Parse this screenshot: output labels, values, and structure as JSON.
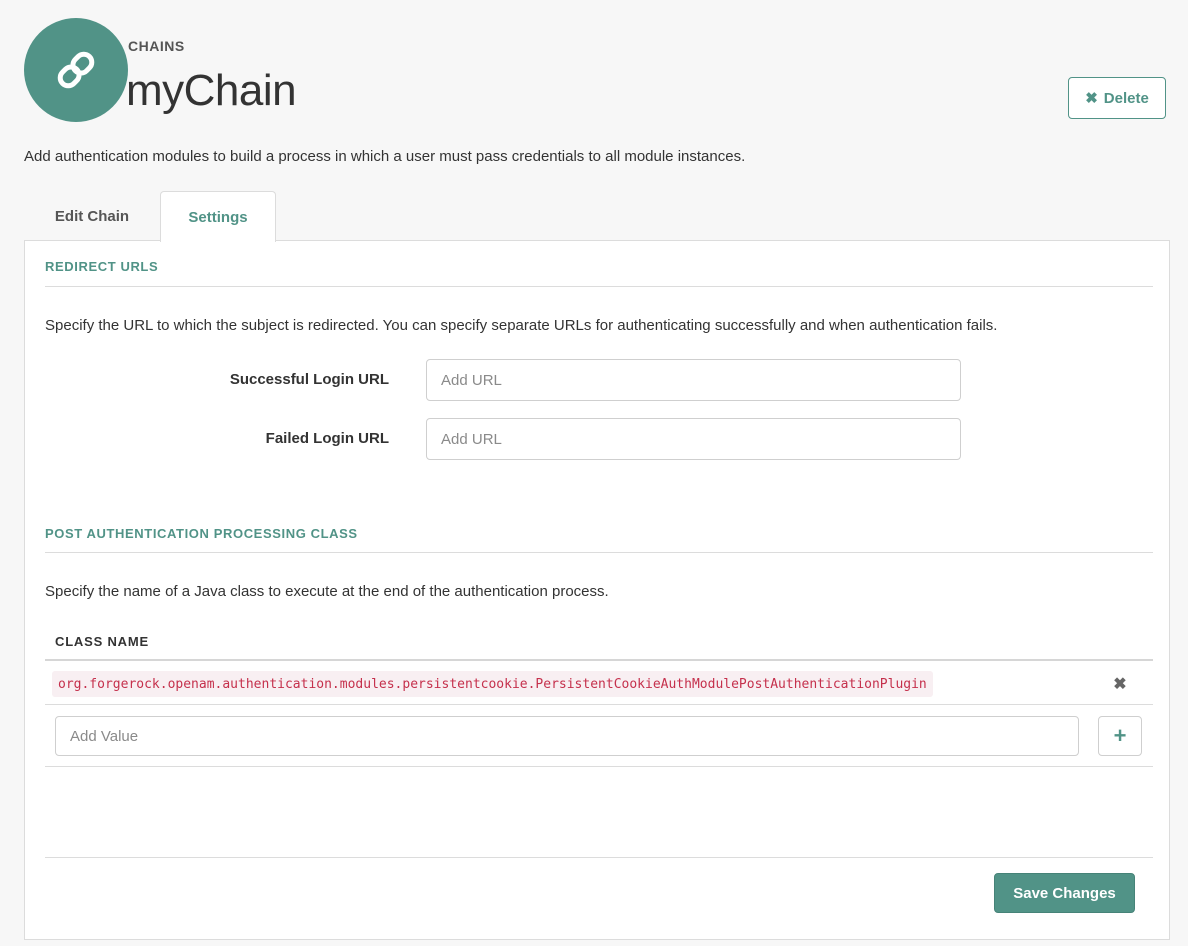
{
  "header": {
    "eyebrow": "CHAINS",
    "title": "myChain",
    "delete_label": "Delete",
    "icon": "link-icon",
    "accent_color": "#519387"
  },
  "intro": "Add authentication modules to build a process in which a user must pass credentials to all module instances.",
  "tabs": [
    {
      "label": "Edit Chain",
      "active": false
    },
    {
      "label": "Settings",
      "active": true
    }
  ],
  "redirect": {
    "section_title": "REDIRECT URLS",
    "description": "Specify the URL to which the subject is redirected. You can specify separate URLs for authenticating successfully and when authentication fails.",
    "fields": [
      {
        "label": "Successful Login URL",
        "value": "",
        "placeholder": "Add URL"
      },
      {
        "label": "Failed Login URL",
        "value": "",
        "placeholder": "Add URL"
      }
    ]
  },
  "post_auth": {
    "section_title": "POST AUTHENTICATION PROCESSING CLASS",
    "description": "Specify the name of a Java class to execute at the end of the authentication process.",
    "column_header": "CLASS NAME",
    "values": [
      "org.forgerock.openam.authentication.modules.persistentcookie.PersistentCookieAuthModulePostAuthenticationPlugin"
    ],
    "add_placeholder": "Add Value"
  },
  "footer": {
    "save_label": "Save Changes"
  }
}
